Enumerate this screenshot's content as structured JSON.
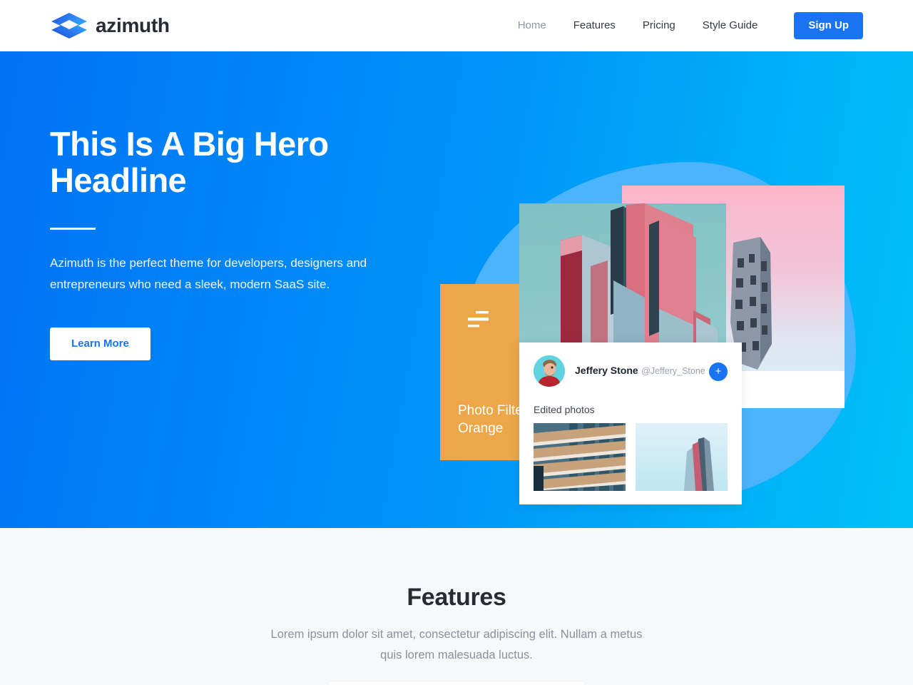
{
  "header": {
    "brand": {
      "name": "azimuth",
      "logo_icon": "diamond-stack-logo-icon"
    },
    "nav": [
      {
        "label": "Home",
        "active": true
      },
      {
        "label": "Features",
        "active": false
      },
      {
        "label": "Pricing",
        "active": false
      },
      {
        "label": "Style Guide",
        "active": false
      }
    ],
    "signup_label": "Sign Up"
  },
  "hero": {
    "title": "This Is A Big Hero Headline",
    "subtitle": "Azimuth is the perfect theme for developers, designers and entrepreneurs who need a sleek, modern SaaS site.",
    "cta_label": "Learn More",
    "art": {
      "orange_card": {
        "label": "Photo Filter Orange",
        "icon": "filter-sliders-icon"
      },
      "profile_card": {
        "name": "Jeffery Stone",
        "handle": "@Jeffery_Stone",
        "add_label": "+",
        "section_label": "Edited photos",
        "thumbnails": [
          {
            "alt": "balcony-building-photo"
          },
          {
            "alt": "pink-tower-photo"
          }
        ]
      },
      "main_photo_alt": "pink-and-blue-angular-architecture-photo",
      "pink_card_alt": "pink-gradient-card-with-tower"
    }
  },
  "features": {
    "title": "Features",
    "subtitle": "Lorem ipsum dolor sit amet, consectetur adipiscing elit. Nullam a metus quis lorem malesuada luctus."
  },
  "colors": {
    "brand_blue": "#1a73f0",
    "hero_gradient_start": "#0072f5",
    "hero_gradient_end": "#00c2f7",
    "blob_blue": "#4cb4fb",
    "orange_card": "#eda648",
    "pink_card_top": "#fbb6cb",
    "pink_card_bottom": "#d6f1f3",
    "page_background": "#f7f8fa",
    "heading_text": "#262b35",
    "muted_text": "#8a919b"
  }
}
